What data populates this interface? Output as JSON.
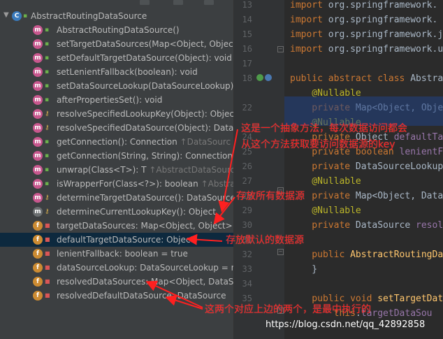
{
  "structure": {
    "root": {
      "label": "AbstractRoutingDataSource",
      "icon": "abstract-class-icon"
    },
    "members": [
      {
        "kind": "m",
        "vis": "pub",
        "label": "AbstractRoutingDataSource()",
        "inherited": ""
      },
      {
        "kind": "m",
        "vis": "pub",
        "label": "setTargetDataSources(Map<Object, Object",
        "inherited": ""
      },
      {
        "kind": "m",
        "vis": "pub",
        "label": "setDefaultTargetDataSource(Object): void",
        "inherited": ""
      },
      {
        "kind": "m",
        "vis": "pub",
        "label": "setLenientFallback(boolean): void",
        "inherited": ""
      },
      {
        "kind": "m",
        "vis": "pub",
        "label": "setDataSourceLookup(DataSourceLookup):",
        "inherited": ""
      },
      {
        "kind": "m",
        "vis": "pub",
        "label": "afterPropertiesSet(): void",
        "inherited": ""
      },
      {
        "kind": "m",
        "vis": "prot",
        "label": "resolveSpecifiedLookupKey(Object): Object",
        "inherited": ""
      },
      {
        "kind": "m",
        "vis": "prot",
        "label": "resolveSpecifiedDataSource(Object): DataSo",
        "inherited": ""
      },
      {
        "kind": "m",
        "vis": "pub",
        "label": "getConnection(): Connection ",
        "inherited": "↑DataSourc"
      },
      {
        "kind": "m",
        "vis": "pub",
        "label": "getConnection(String, String): Connection ",
        "inherited": "↑D"
      },
      {
        "kind": "m",
        "vis": "pub",
        "label": "unwrap(Class<T>): T ",
        "inherited": "↑AbstractDataSource"
      },
      {
        "kind": "m",
        "vis": "pub",
        "label": "isWrapperFor(Class<?>): boolean ",
        "inherited": "↑Abstrac"
      },
      {
        "kind": "m",
        "vis": "prot",
        "label": "determineTargetDataSource(): DataSource",
        "inherited": ""
      },
      {
        "kind": "ma",
        "vis": "prot",
        "label": "determineCurrentLookupKey(): Object",
        "inherited": ""
      },
      {
        "kind": "f",
        "vis": "priv",
        "label": "targetDataSources: Map<Object, Object>",
        "inherited": ""
      },
      {
        "kind": "f",
        "vis": "priv",
        "label": "defaultTargetDataSource: Object",
        "inherited": ""
      },
      {
        "kind": "f",
        "vis": "priv",
        "label": "lenientFallback: boolean = true",
        "inherited": ""
      },
      {
        "kind": "f",
        "vis": "priv",
        "label": "dataSourceLookup: DataSourceLookup = n",
        "inherited": ""
      },
      {
        "kind": "f",
        "vis": "priv",
        "label": "resolvedDataSources: Map<Object, DataSo",
        "inherited": ""
      },
      {
        "kind": "f",
        "vis": "priv",
        "label": "resolvedDefaultDataSource: DataSource",
        "inherited": ""
      }
    ],
    "selected_index": 15
  },
  "gutter": {
    "line_numbers": [
      "13",
      "14",
      "15",
      "16",
      "17",
      "18",
      "",
      "22",
      "",
      "24",
      "25",
      "26",
      "27",
      "28",
      "29",
      "30",
      "31",
      "32",
      "33",
      "34",
      "35"
    ]
  },
  "editor": {
    "lines": [
      {
        "parts": [
          {
            "c": "kw",
            "t": "import "
          },
          {
            "c": "",
            "t": "org.springframework."
          }
        ]
      },
      {
        "parts": [
          {
            "c": "kw",
            "t": "import "
          },
          {
            "c": "",
            "t": "org.springframework."
          }
        ]
      },
      {
        "parts": [
          {
            "c": "kw",
            "t": "import "
          },
          {
            "c": "",
            "t": "org.springframework.j"
          }
        ]
      },
      {
        "parts": [
          {
            "c": "kw",
            "t": "import "
          },
          {
            "c": "",
            "t": "org.springframework.u"
          }
        ]
      },
      {
        "parts": []
      },
      {
        "parts": [
          {
            "c": "kw",
            "t": "public abstract class "
          },
          {
            "c": "",
            "t": "Abstra"
          }
        ]
      },
      {
        "parts": [
          {
            "c": "ann",
            "t": "    @Nullable"
          }
        ]
      },
      {
        "parts": [
          {
            "c": "kw",
            "t": "    private "
          },
          {
            "c": "",
            "t": "Map<Object, "
          },
          {
            "c": "",
            "t": "Obje"
          }
        ]
      },
      {
        "parts": [
          {
            "c": "ann",
            "t": "    @Nullable"
          }
        ]
      },
      {
        "parts": [
          {
            "c": "kw",
            "t": "    private "
          },
          {
            "c": "",
            "t": "Object "
          },
          {
            "c": "fld",
            "t": "defaultTa"
          }
        ]
      },
      {
        "parts": [
          {
            "c": "kw",
            "t": "    private boolean "
          },
          {
            "c": "fld",
            "t": "lenientF"
          }
        ]
      },
      {
        "parts": [
          {
            "c": "kw",
            "t": "    private "
          },
          {
            "c": "",
            "t": "DataSourceLookup"
          }
        ]
      },
      {
        "parts": [
          {
            "c": "ann",
            "t": "    @Nullable"
          }
        ]
      },
      {
        "parts": [
          {
            "c": "kw",
            "t": "    private "
          },
          {
            "c": "",
            "t": "Map<Object, Data"
          }
        ]
      },
      {
        "parts": [
          {
            "c": "ann",
            "t": "    @Nullable"
          }
        ]
      },
      {
        "parts": [
          {
            "c": "kw",
            "t": "    private "
          },
          {
            "c": "",
            "t": "DataSource "
          },
          {
            "c": "fld",
            "t": "resol"
          }
        ]
      },
      {
        "parts": []
      },
      {
        "parts": [
          {
            "c": "kw",
            "t": "    public "
          },
          {
            "c": "mth",
            "t": "AbstractRoutingDa"
          }
        ]
      },
      {
        "parts": [
          {
            "c": "",
            "t": "    }"
          }
        ]
      },
      {
        "parts": []
      },
      {
        "parts": [
          {
            "c": "kw",
            "t": "    public void "
          },
          {
            "c": "mth",
            "t": "setTargetDat"
          }
        ]
      },
      {
        "parts": [
          {
            "c": "kw",
            "t": "        this"
          },
          {
            "c": "",
            "t": "."
          },
          {
            "c": "fld",
            "t": "targetDataSou"
          }
        ]
      }
    ]
  },
  "annotations": {
    "abstract_method_note_line1": "这是一个抽象方法，每次数据访问都会",
    "abstract_method_note_line2": "从这个方法获取要访问数据源的key",
    "all_sources_note": "存放所有数据源",
    "default_source_note": "存放默认的数据源",
    "resolved_note": "这两个对应上边的两个，是最中执行的"
  },
  "watermark": "https://blog.csdn.net/qq_42892858",
  "colors": {
    "annotation": "#ff2020",
    "selection": "#0d293e",
    "method_icon": "#c8578e",
    "field_icon": "#cc8b32"
  }
}
